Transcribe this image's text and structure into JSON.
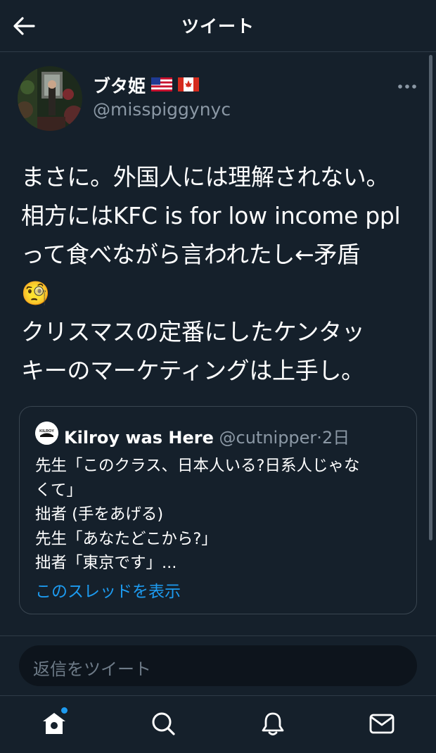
{
  "header": {
    "title": "ツイート",
    "back_icon": "arrow-left-icon"
  },
  "tweet": {
    "author": {
      "display_name": "ブタ姫",
      "flags": [
        "🇺🇸",
        "🇨🇦"
      ],
      "handle": "@misspiggynyc"
    },
    "more_icon": "ellipsis-icon",
    "text": "まさに。外国人には理解されない。\n相方にはKFC is for low income ppl\nって食べながら言われたし←矛盾\n🧐\nクリスマスの定番にしたケンタッ\nキーのマーケティングは上手し。",
    "quoted": {
      "display_name": "Kilroy was Here",
      "handle": "@cutnipper",
      "separator": "·",
      "age": "2日",
      "avatar_text": "KILROY",
      "text": "先生「このクラス、日本人いる?日系人じゃな\nくて」\n拙者 (手をあげる)\n先生「あなたどこから?」\n拙者「東京です」...",
      "show_thread": "このスレッドを表示"
    }
  },
  "reply": {
    "placeholder": "返信をツイート"
  },
  "tabbar": {
    "items": [
      {
        "icon": "home-icon",
        "has_badge": true
      },
      {
        "icon": "search-icon"
      },
      {
        "icon": "bell-icon"
      },
      {
        "icon": "mail-icon"
      }
    ]
  },
  "colors": {
    "background": "#15202b",
    "accent": "#1d9bf0",
    "secondary_text": "#8b98a5"
  }
}
